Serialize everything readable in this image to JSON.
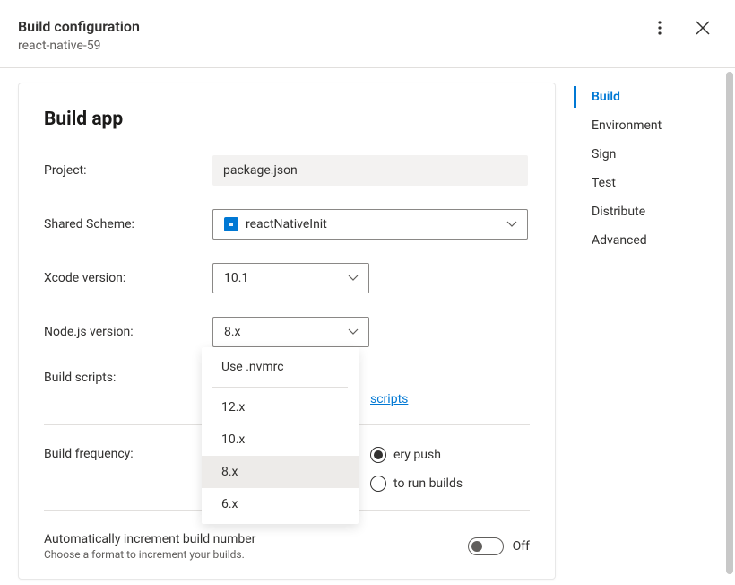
{
  "header": {
    "title": "Build configuration",
    "subtitle": "react-native-59"
  },
  "card": {
    "title": "Build app"
  },
  "form": {
    "project_label": "Project:",
    "project_value": "package.json",
    "scheme_label": "Shared Scheme:",
    "scheme_value": "reactNativeInit",
    "xcode_label": "Xcode version:",
    "xcode_value": "10.1",
    "node_label": "Node.js version:",
    "node_value": "8.x",
    "scripts_label": "Build scripts:",
    "scripts_link": "scripts",
    "frequency_label": "Build frequency:",
    "frequency_options": [
      {
        "label": "ery push",
        "checked": true
      },
      {
        "label": "to run builds",
        "checked": false
      }
    ],
    "auto_increment_title": "Automatically increment build number",
    "auto_increment_desc": "Choose a format to increment your builds.",
    "auto_increment_state": "Off"
  },
  "node_dropdown": {
    "groups": [
      [
        "Use .nvmrc"
      ],
      [
        "12.x",
        "10.x",
        "8.x",
        "6.x"
      ]
    ],
    "selected": "8.x"
  },
  "side_nav": [
    {
      "label": "Build",
      "active": true
    },
    {
      "label": "Environment",
      "active": false
    },
    {
      "label": "Sign",
      "active": false
    },
    {
      "label": "Test",
      "active": false
    },
    {
      "label": "Distribute",
      "active": false
    },
    {
      "label": "Advanced",
      "active": false
    }
  ]
}
